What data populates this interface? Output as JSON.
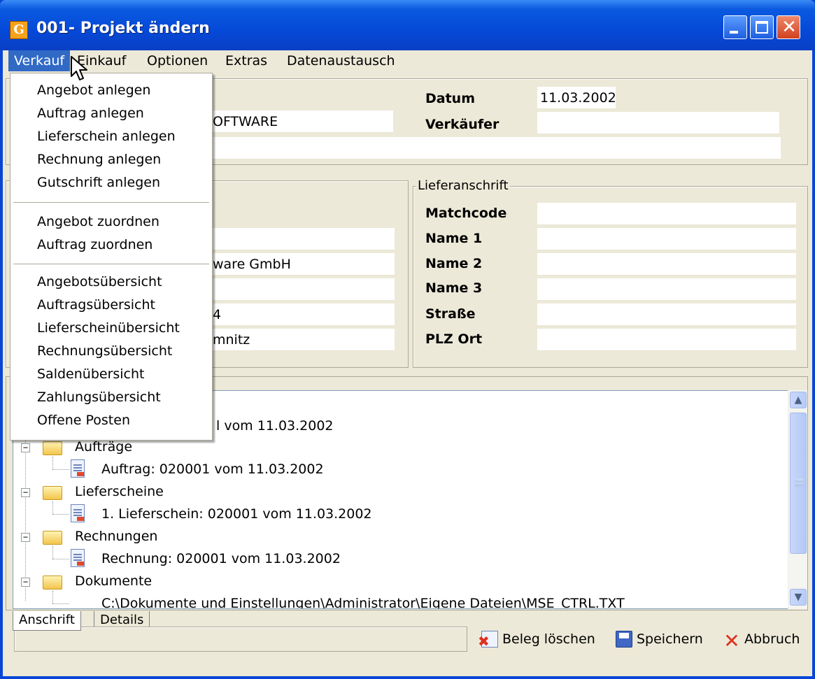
{
  "window": {
    "title": "001- Projekt ändern",
    "app_icon_glyph": "G",
    "close_glyph": "✕"
  },
  "menubar": {
    "items": [
      "Verkauf",
      "Einkauf",
      "Optionen",
      "Extras",
      "Datenaustausch"
    ]
  },
  "dropdown": {
    "items": [
      "Angebot anlegen",
      "Auftrag anlegen",
      "Lieferschein anlegen",
      "Rechnung anlegen",
      "Gutschrift anlegen",
      "Angebot zuordnen",
      "Auftrag zuordnen",
      "Angebotsübersicht",
      "Auftragsübersicht",
      "Lieferscheinübersicht",
      "Rechnungsübersicht",
      "Saldenübersicht",
      "Zahlungsübersicht",
      "Offene Posten"
    ]
  },
  "header": {
    "datum_label": "Datum",
    "datum_value": "11.03.2002",
    "verkaeufer_label": "Verkäufer",
    "verkaeufer_value": "",
    "partial_value_1": "OFTWARE"
  },
  "left_address": {
    "values": [
      "",
      "ware GmbH",
      "",
      "4",
      "mnitz"
    ]
  },
  "lieferanschrift": {
    "title": "Lieferanschrift",
    "labels": [
      "Matchcode",
      "Name 1",
      "Name 2",
      "Name 3",
      "Straße",
      "PLZ Ort"
    ],
    "values": [
      "",
      "",
      "",
      "",
      "",
      ""
    ]
  },
  "tree": {
    "partial_top": "l vom 11.03.2002",
    "nodes": [
      {
        "folder": "Aufträge",
        "child": "Auftrag: 020001 vom 11.03.2002"
      },
      {
        "folder": "Lieferscheine",
        "child": "1. Lieferschein: 020001 vom 11.03.2002"
      },
      {
        "folder": "Rechnungen",
        "child": "Rechnung: 020001 vom 11.03.2002"
      },
      {
        "folder": "Dokumente",
        "child": "C:\\Dokumente und Einstellungen\\Administrator\\Eigene Dateien\\MSE_CTRL.TXT"
      }
    ]
  },
  "tabs": [
    "Anschrift",
    "Details"
  ],
  "actions": {
    "delete": "Beleg löschen",
    "save": "Speichern",
    "cancel": "Abbruch"
  },
  "icons": {
    "scroll_up": "▲",
    "scroll_down": "▼",
    "expander_minus": "−",
    "cancel_glyph": "✕"
  }
}
